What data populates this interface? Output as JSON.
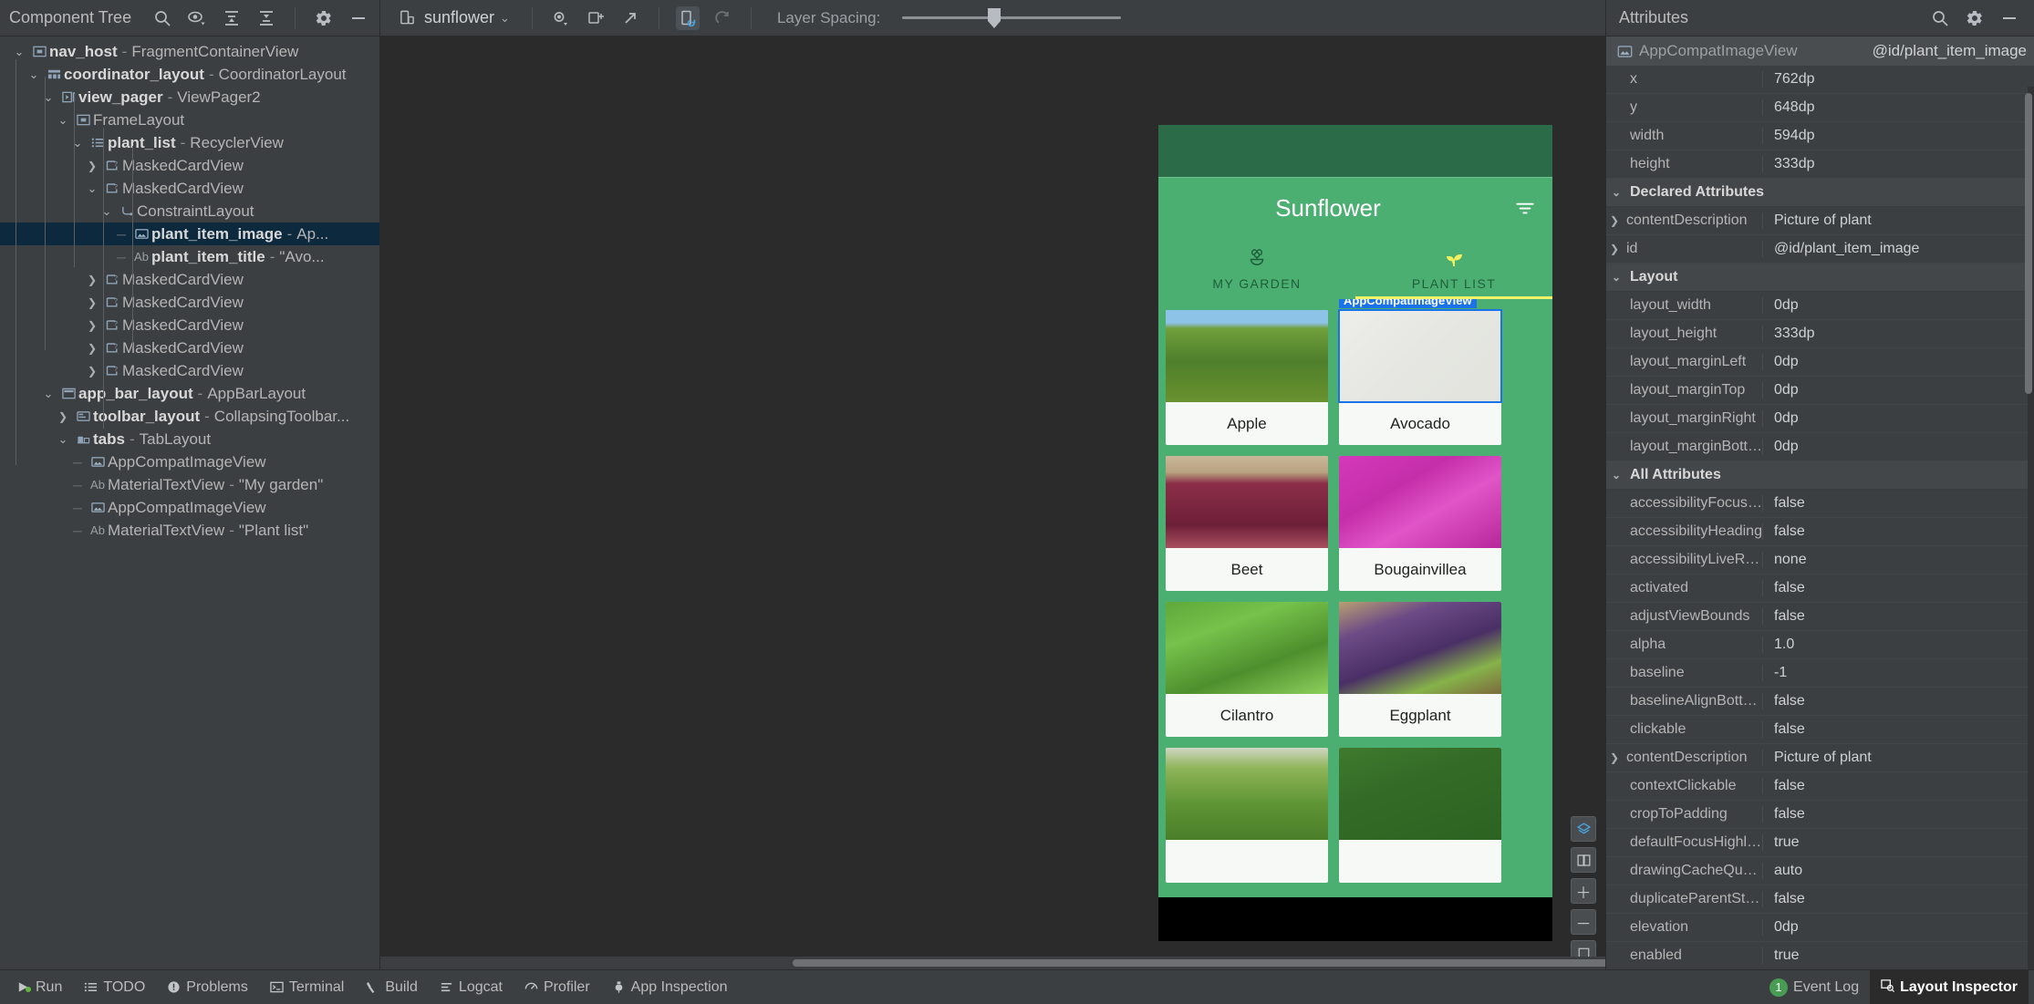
{
  "toolbar": {
    "tree_panel_title": "Component Tree",
    "tree_icons": [
      "search-icon",
      "eye-dropdown-icon",
      "expand-all-icon",
      "collapse-all-icon",
      "settings-icon",
      "minimize-icon"
    ],
    "device_label": "sunflower",
    "layer_spacing_label": "Layer Spacing:",
    "main_icons": [
      "eye-dropdown-icon",
      "snapshot-icon",
      "export-icon",
      "live-updates-icon",
      "refresh-icon"
    ],
    "attributes_panel_title": "Attributes",
    "attr_icons": [
      "search-icon",
      "settings-icon",
      "minimize-icon"
    ]
  },
  "tree": {
    "nodes": [
      {
        "depth": 0,
        "chev": "v",
        "icon": "fragment-container-icon",
        "name": "nav_host",
        "sep": " - ",
        "type": "FragmentContainerView",
        "bold": true,
        "selected": false
      },
      {
        "depth": 1,
        "chev": "v",
        "icon": "coordinator-layout-icon",
        "name": "coordinator_layout",
        "sep": " - ",
        "type": "CoordinatorLayout",
        "bold": true,
        "selected": false
      },
      {
        "depth": 2,
        "chev": "v",
        "icon": "viewpager-icon",
        "name": "view_pager",
        "sep": " - ",
        "type": "ViewPager2",
        "bold": true,
        "selected": false
      },
      {
        "depth": 3,
        "chev": "v",
        "icon": "framelayout-icon",
        "name": "FrameLayout",
        "sep": "",
        "type": "",
        "bold": false,
        "selected": false
      },
      {
        "depth": 4,
        "chev": "v",
        "icon": "recyclerview-icon",
        "name": "plant_list",
        "sep": " - ",
        "type": "RecyclerView",
        "bold": true,
        "selected": false
      },
      {
        "depth": 5,
        "chev": ">",
        "icon": "cardview-icon",
        "name": "MaskedCardView",
        "sep": "",
        "type": "",
        "bold": false,
        "selected": false
      },
      {
        "depth": 5,
        "chev": "v",
        "icon": "cardview-icon",
        "name": "MaskedCardView",
        "sep": "",
        "type": "",
        "bold": false,
        "selected": false
      },
      {
        "depth": 6,
        "chev": "v",
        "icon": "constraintlayout-icon",
        "name": "ConstraintLayout",
        "sep": "",
        "type": "",
        "bold": false,
        "selected": false
      },
      {
        "depth": 7,
        "chev": "",
        "icon": "image-icon",
        "name": "plant_item_image",
        "sep": " - ",
        "type": "Ap...",
        "bold": true,
        "selected": true
      },
      {
        "depth": 7,
        "chev": "",
        "icon": "ab-text-icon",
        "name": "plant_item_title",
        "sep": " - ",
        "type": "\"Avo...",
        "bold": true,
        "selected": false
      },
      {
        "depth": 5,
        "chev": ">",
        "icon": "cardview-icon",
        "name": "MaskedCardView",
        "sep": "",
        "type": "",
        "bold": false,
        "selected": false
      },
      {
        "depth": 5,
        "chev": ">",
        "icon": "cardview-icon",
        "name": "MaskedCardView",
        "sep": "",
        "type": "",
        "bold": false,
        "selected": false
      },
      {
        "depth": 5,
        "chev": ">",
        "icon": "cardview-icon",
        "name": "MaskedCardView",
        "sep": "",
        "type": "",
        "bold": false,
        "selected": false
      },
      {
        "depth": 5,
        "chev": ">",
        "icon": "cardview-icon",
        "name": "MaskedCardView",
        "sep": "",
        "type": "",
        "bold": false,
        "selected": false
      },
      {
        "depth": 5,
        "chev": ">",
        "icon": "cardview-icon",
        "name": "MaskedCardView",
        "sep": "",
        "type": "",
        "bold": false,
        "selected": false
      },
      {
        "depth": 2,
        "chev": "v",
        "icon": "appbarlayout-icon",
        "name": "app_bar_layout",
        "sep": " - ",
        "type": "AppBarLayout",
        "bold": true,
        "selected": false
      },
      {
        "depth": 3,
        "chev": ">",
        "icon": "toolbar-icon",
        "name": "toolbar_layout",
        "sep": " - ",
        "type": "CollapsingToolbar...",
        "bold": true,
        "selected": false
      },
      {
        "depth": 3,
        "chev": "v",
        "icon": "tablayout-icon",
        "name": "tabs",
        "sep": " - ",
        "type": "TabLayout",
        "bold": true,
        "selected": false
      },
      {
        "depth": 4,
        "chev": "",
        "icon": "image-icon",
        "name": "AppCompatImageView",
        "sep": "",
        "type": "",
        "bold": false,
        "selected": false
      },
      {
        "depth": 4,
        "chev": "",
        "icon": "ab-text-icon",
        "name": "MaterialTextView",
        "sep": " - ",
        "type": "\"My garden\"",
        "bold": false,
        "selected": false
      },
      {
        "depth": 4,
        "chev": "",
        "icon": "image-icon",
        "name": "AppCompatImageView",
        "sep": "",
        "type": "",
        "bold": false,
        "selected": false
      },
      {
        "depth": 4,
        "chev": "",
        "icon": "ab-text-icon",
        "name": "MaterialTextView",
        "sep": " - ",
        "type": "\"Plant list\"",
        "bold": false,
        "selected": false
      }
    ]
  },
  "preview": {
    "app_title": "Sunflower",
    "filter_icon": "filter-icon",
    "tabs": [
      {
        "label": "MY GARDEN",
        "icon": "flower-icon",
        "active": false
      },
      {
        "label": "PLANT LIST",
        "icon": "sprout-icon",
        "active": true
      }
    ],
    "selection_badge": "AppCompatImageView",
    "cards": [
      {
        "title": "Apple",
        "image": "apple-orchard-photo",
        "selected": false
      },
      {
        "title": "Avocado",
        "image": "avocado-branch-photo",
        "selected": true
      },
      {
        "title": "Beet",
        "image": "beet-crate-photo",
        "selected": false
      },
      {
        "title": "Bougainvillea",
        "image": "bougainvillea-photo",
        "selected": false
      },
      {
        "title": "Cilantro",
        "image": "cilantro-photo",
        "selected": false
      },
      {
        "title": "Eggplant",
        "image": "eggplant-photo",
        "selected": false
      },
      {
        "title": "",
        "image": "flower-bush-photo",
        "selected": false
      },
      {
        "title": "",
        "image": "hibiscus-photo",
        "selected": false
      }
    ],
    "canvas_tools": [
      "layers-icon",
      "compare-icon",
      "zoom-in-icon",
      "zoom-out-icon",
      "zoom-fit-icon"
    ]
  },
  "attributes": {
    "header": {
      "view_type": "AppCompatImageView",
      "view_id": "@id/plant_item_image",
      "icon": "image-icon"
    },
    "basic": [
      {
        "key": "x",
        "value": "762dp"
      },
      {
        "key": "y",
        "value": "648dp"
      },
      {
        "key": "width",
        "value": "594dp"
      },
      {
        "key": "height",
        "value": "333dp"
      }
    ],
    "sections": [
      {
        "title": "Declared Attributes",
        "rows": [
          {
            "key": "contentDescription",
            "value": "Picture of plant",
            "expandable": true
          },
          {
            "key": "id",
            "value": "@id/plant_item_image",
            "expandable": true
          }
        ]
      },
      {
        "title": "Layout",
        "rows": [
          {
            "key": "layout_width",
            "value": "0dp",
            "expandable": false
          },
          {
            "key": "layout_height",
            "value": "333dp",
            "expandable": false
          },
          {
            "key": "layout_marginLeft",
            "value": "0dp",
            "expandable": false
          },
          {
            "key": "layout_marginTop",
            "value": "0dp",
            "expandable": false
          },
          {
            "key": "layout_marginRight",
            "value": "0dp",
            "expandable": false
          },
          {
            "key": "layout_marginBottom",
            "value": "0dp",
            "expandable": false
          }
        ]
      },
      {
        "title": "All Attributes",
        "rows": [
          {
            "key": "accessibilityFocused",
            "value": "false",
            "expandable": false
          },
          {
            "key": "accessibilityHeading",
            "value": "false",
            "expandable": false
          },
          {
            "key": "accessibilityLiveRegion",
            "value": "none",
            "expandable": false
          },
          {
            "key": "activated",
            "value": "false",
            "expandable": false
          },
          {
            "key": "adjustViewBounds",
            "value": "false",
            "expandable": false
          },
          {
            "key": "alpha",
            "value": "1.0",
            "expandable": false
          },
          {
            "key": "baseline",
            "value": "-1",
            "expandable": false
          },
          {
            "key": "baselineAlignBottom",
            "value": "false",
            "expandable": false
          },
          {
            "key": "clickable",
            "value": "false",
            "expandable": false
          },
          {
            "key": "contentDescription",
            "value": "Picture of plant",
            "expandable": true
          },
          {
            "key": "contextClickable",
            "value": "false",
            "expandable": false
          },
          {
            "key": "cropToPadding",
            "value": "false",
            "expandable": false
          },
          {
            "key": "defaultFocusHighlight...",
            "value": "true",
            "expandable": false
          },
          {
            "key": "drawingCacheQuality",
            "value": "auto",
            "expandable": false
          },
          {
            "key": "duplicateParentState",
            "value": "false",
            "expandable": false
          },
          {
            "key": "elevation",
            "value": "0dp",
            "expandable": false
          },
          {
            "key": "enabled",
            "value": "true",
            "expandable": false
          }
        ]
      }
    ]
  },
  "statusbar": {
    "left_items": [
      {
        "label": "Run",
        "icon": "run-icon"
      },
      {
        "label": "TODO",
        "icon": "todo-icon"
      },
      {
        "label": "Problems",
        "icon": "problems-icon"
      },
      {
        "label": "Terminal",
        "icon": "terminal-icon"
      },
      {
        "label": "Build",
        "icon": "build-icon"
      },
      {
        "label": "Logcat",
        "icon": "logcat-icon"
      },
      {
        "label": "Profiler",
        "icon": "profiler-icon"
      },
      {
        "label": "App Inspection",
        "icon": "app-inspection-icon"
      }
    ],
    "right_items": [
      {
        "label": "Event Log",
        "badge": "1",
        "icon": "",
        "active": false
      },
      {
        "label": "Layout Inspector",
        "badge": "",
        "icon": "layout-inspector-icon",
        "active": true
      }
    ]
  },
  "colors": {
    "accent_green": "#4caf72",
    "dark_green": "#2b6b48",
    "selection_blue": "#1a73e8",
    "row_selected": "#0d293e",
    "panel_bg": "#3c3f41",
    "canvas_bg": "#2b2b2b"
  }
}
